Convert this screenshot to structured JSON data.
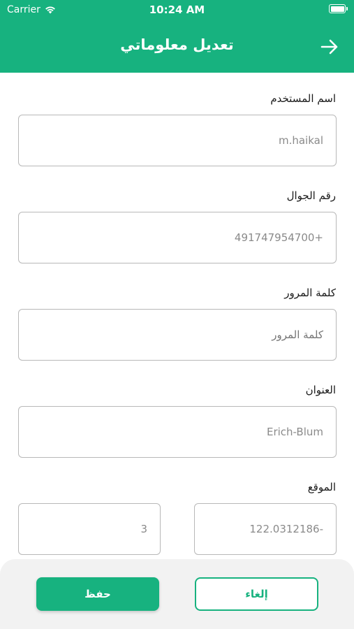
{
  "status_bar": {
    "carrier": "Carrier",
    "time": "10:24 AM"
  },
  "header": {
    "title": "تعديل معلوماتي",
    "back_icon": "arrow-right-icon"
  },
  "form": {
    "username": {
      "label": "اسم المستخدم",
      "value": "m.haikal"
    },
    "mobile": {
      "label": "رقم الجوال",
      "value": "491747954700+"
    },
    "password": {
      "label": "كلمة المرور",
      "placeholder": "كلمة المرور"
    },
    "address": {
      "label": "العنوان",
      "value": "Erich-Blum"
    },
    "location": {
      "label": "الموقع",
      "longitude": "122.0312186-",
      "number": "3"
    }
  },
  "footer": {
    "save_label": "حفظ",
    "cancel_label": "إلغاء"
  },
  "colors": {
    "primary": "#17b27f",
    "border": "#b8b8b8",
    "footer_bg": "#f2f2f2"
  }
}
